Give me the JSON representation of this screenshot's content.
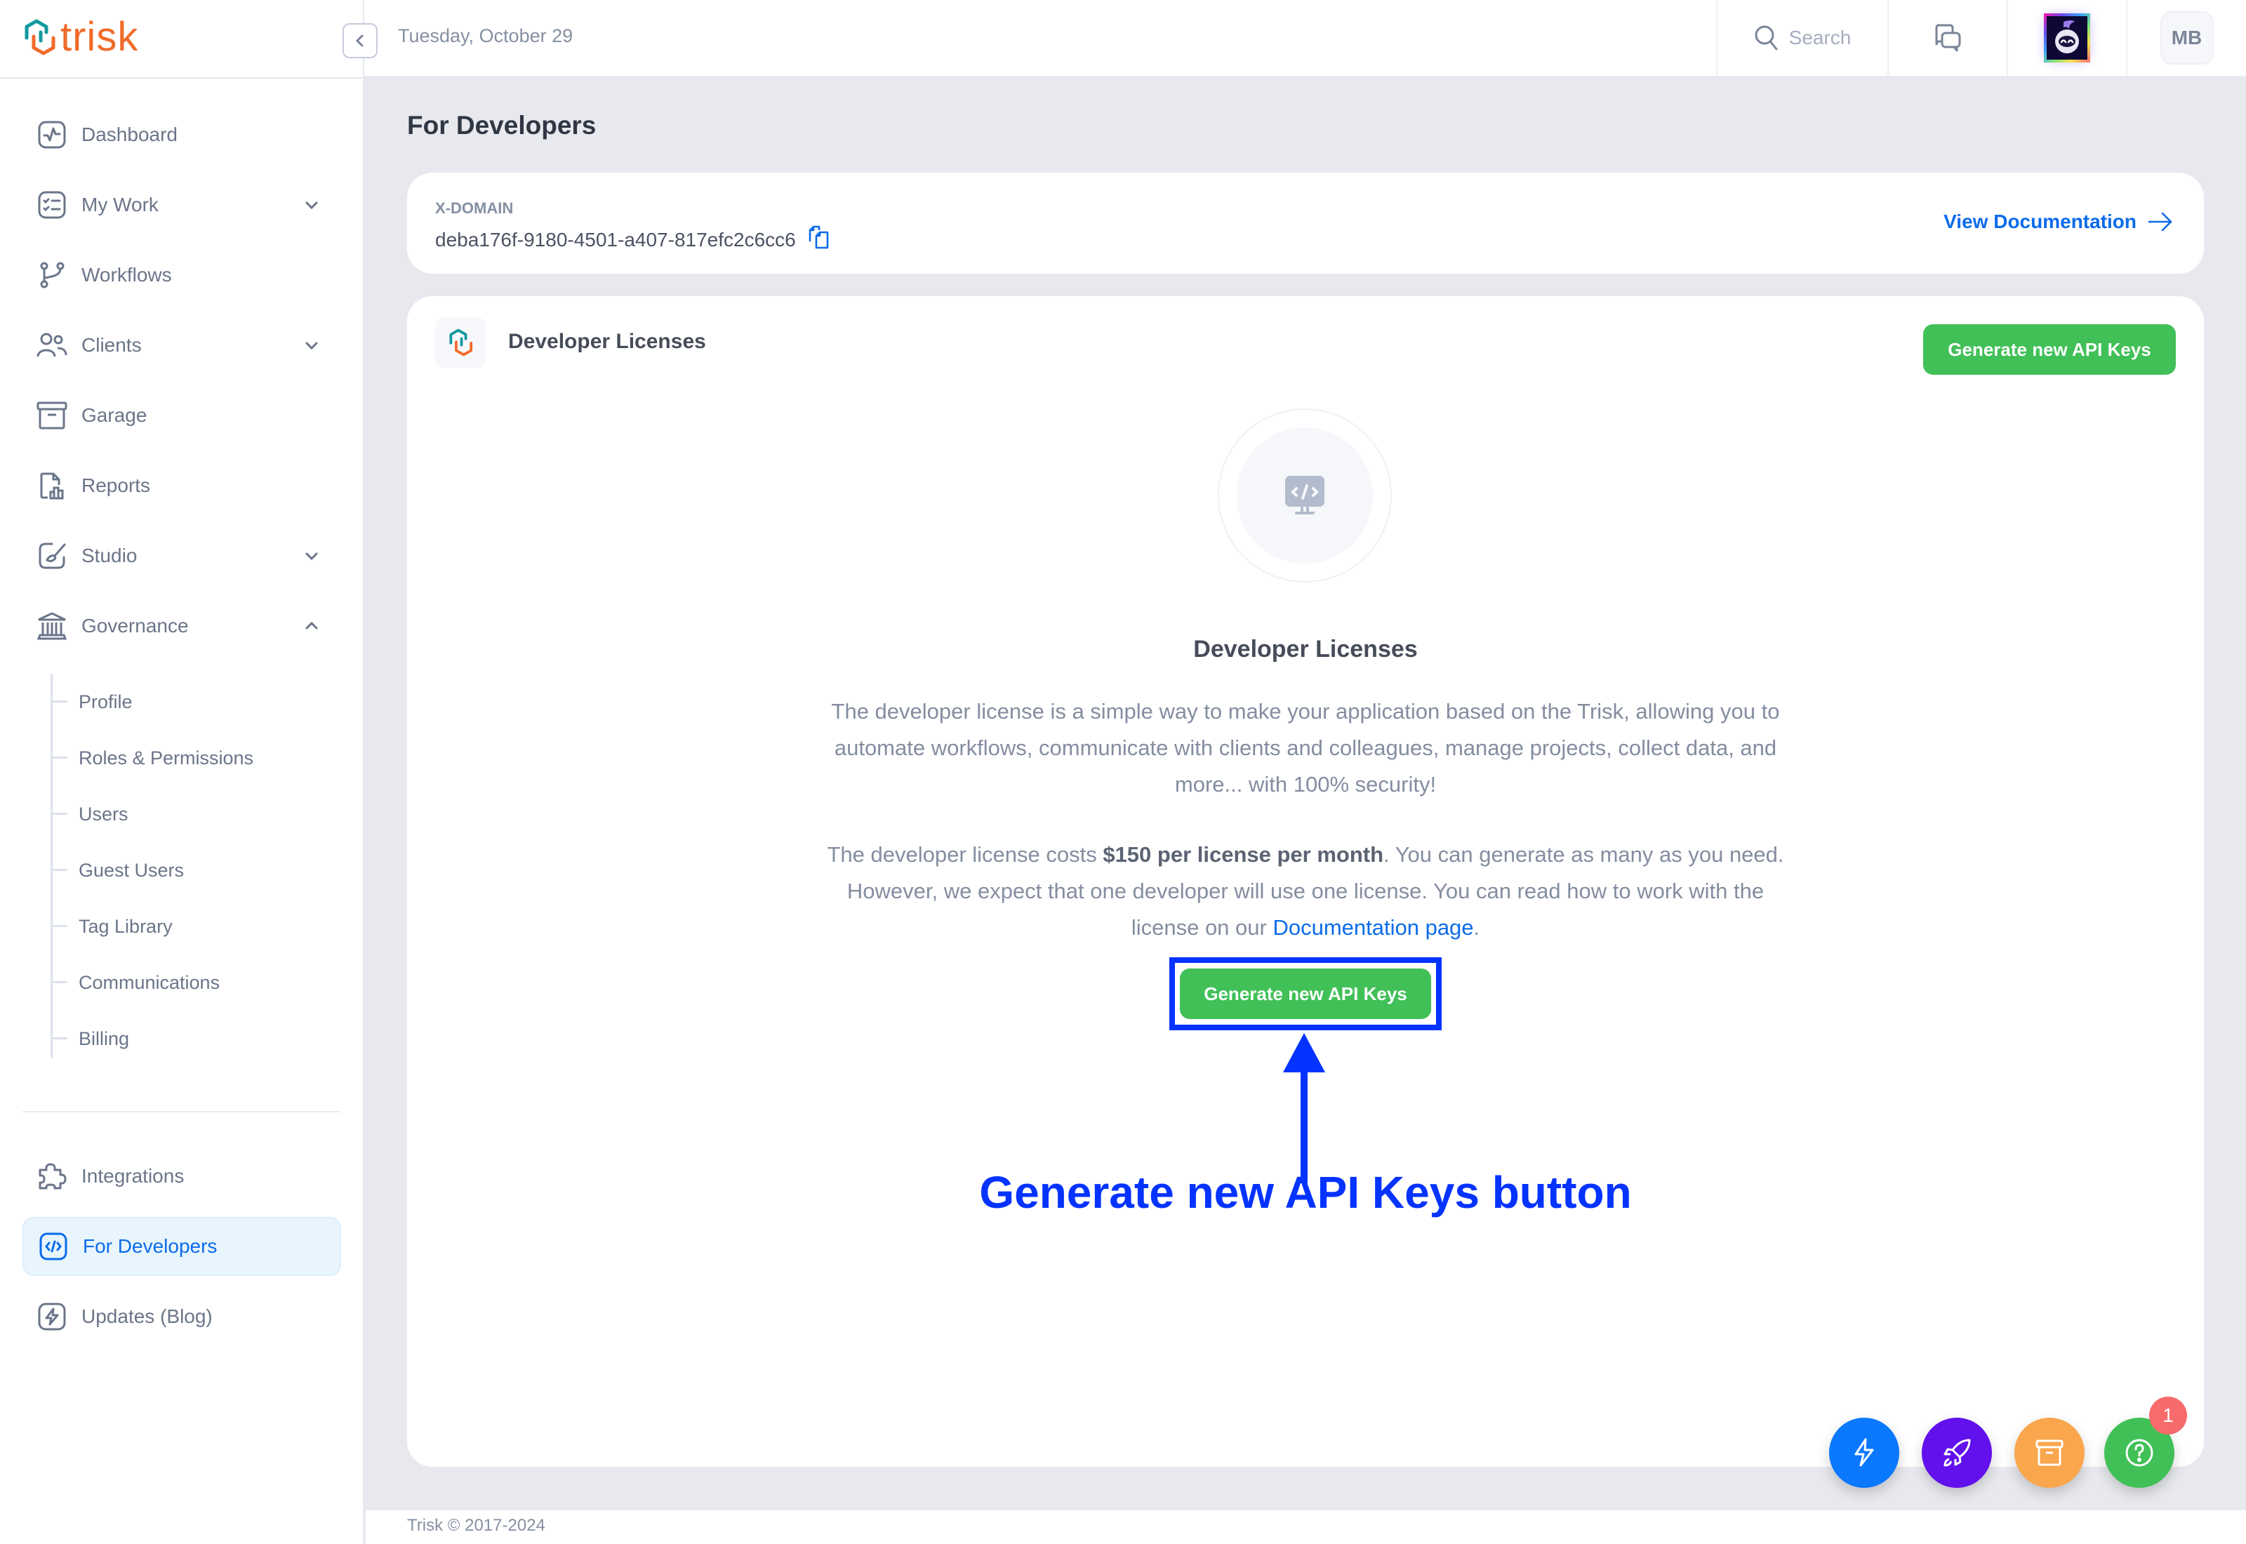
{
  "app": {
    "logo_text": "trisk",
    "brand_colors": {
      "teal": "#11999e",
      "orange": "#f06b2a"
    }
  },
  "header": {
    "date": "Tuesday, October 29",
    "search_placeholder": "Search",
    "user_initials": "MB"
  },
  "sidebar": {
    "items": [
      {
        "label": "Dashboard",
        "icon": "activity-icon",
        "has_chevron": false
      },
      {
        "label": "My Work",
        "icon": "checklist-icon",
        "has_chevron": true,
        "expanded": false
      },
      {
        "label": "Workflows",
        "icon": "git-branch-icon",
        "has_chevron": false
      },
      {
        "label": "Clients",
        "icon": "users-icon",
        "has_chevron": true,
        "expanded": false
      },
      {
        "label": "Garage",
        "icon": "archive-icon",
        "has_chevron": false
      },
      {
        "label": "Reports",
        "icon": "report-icon",
        "has_chevron": false
      },
      {
        "label": "Studio",
        "icon": "brush-icon",
        "has_chevron": true,
        "expanded": false
      },
      {
        "label": "Governance",
        "icon": "bank-icon",
        "has_chevron": true,
        "expanded": true
      }
    ],
    "governance_sub": [
      {
        "label": "Profile"
      },
      {
        "label": "Roles & Permissions"
      },
      {
        "label": "Users"
      },
      {
        "label": "Guest Users"
      },
      {
        "label": "Tag Library"
      },
      {
        "label": "Communications"
      },
      {
        "label": "Billing"
      }
    ],
    "bottom_items": [
      {
        "label": "Integrations",
        "icon": "puzzle-icon",
        "active": false
      },
      {
        "label": "For Developers",
        "icon": "code-icon",
        "active": true
      },
      {
        "label": "Updates (Blog)",
        "icon": "bolt-icon",
        "active": false
      }
    ]
  },
  "main": {
    "page_title": "For Developers",
    "domain_card": {
      "label": "X-DOMAIN",
      "value": "deba176f-9180-4501-a407-817efc2c6cc6",
      "view_docs_label": "View Documentation"
    },
    "licenses_card": {
      "title": "Developer Licenses",
      "generate_button": "Generate new API Keys",
      "empty_title": "Developer Licenses",
      "paragraph1": "The developer license is a simple way to make your application based on the Trisk, allowing you to automate workflows, communicate with clients and colleagues, manage projects, collect data, and more... with 100% security!",
      "paragraph2_prefix": "The developer license costs ",
      "paragraph2_bold": "$150 per license per month",
      "paragraph2_middle": ".  You can generate as many as you need. However, we expect that one developer will use one license. You can read how to work with the license on our ",
      "paragraph2_link": "Documentation page",
      "paragraph2_suffix": ".",
      "center_button": "Generate new API Keys"
    },
    "annotation": {
      "text": "Generate new API Keys button",
      "color": "#0433ff"
    }
  },
  "footer": {
    "text": "Trisk © 2017-2024"
  },
  "fabs": {
    "help_badge_count": "1",
    "colors": {
      "bolt": "#0a78ff",
      "rocket": "#6210ec",
      "box": "#f9a64d",
      "help": "#40c057"
    }
  }
}
